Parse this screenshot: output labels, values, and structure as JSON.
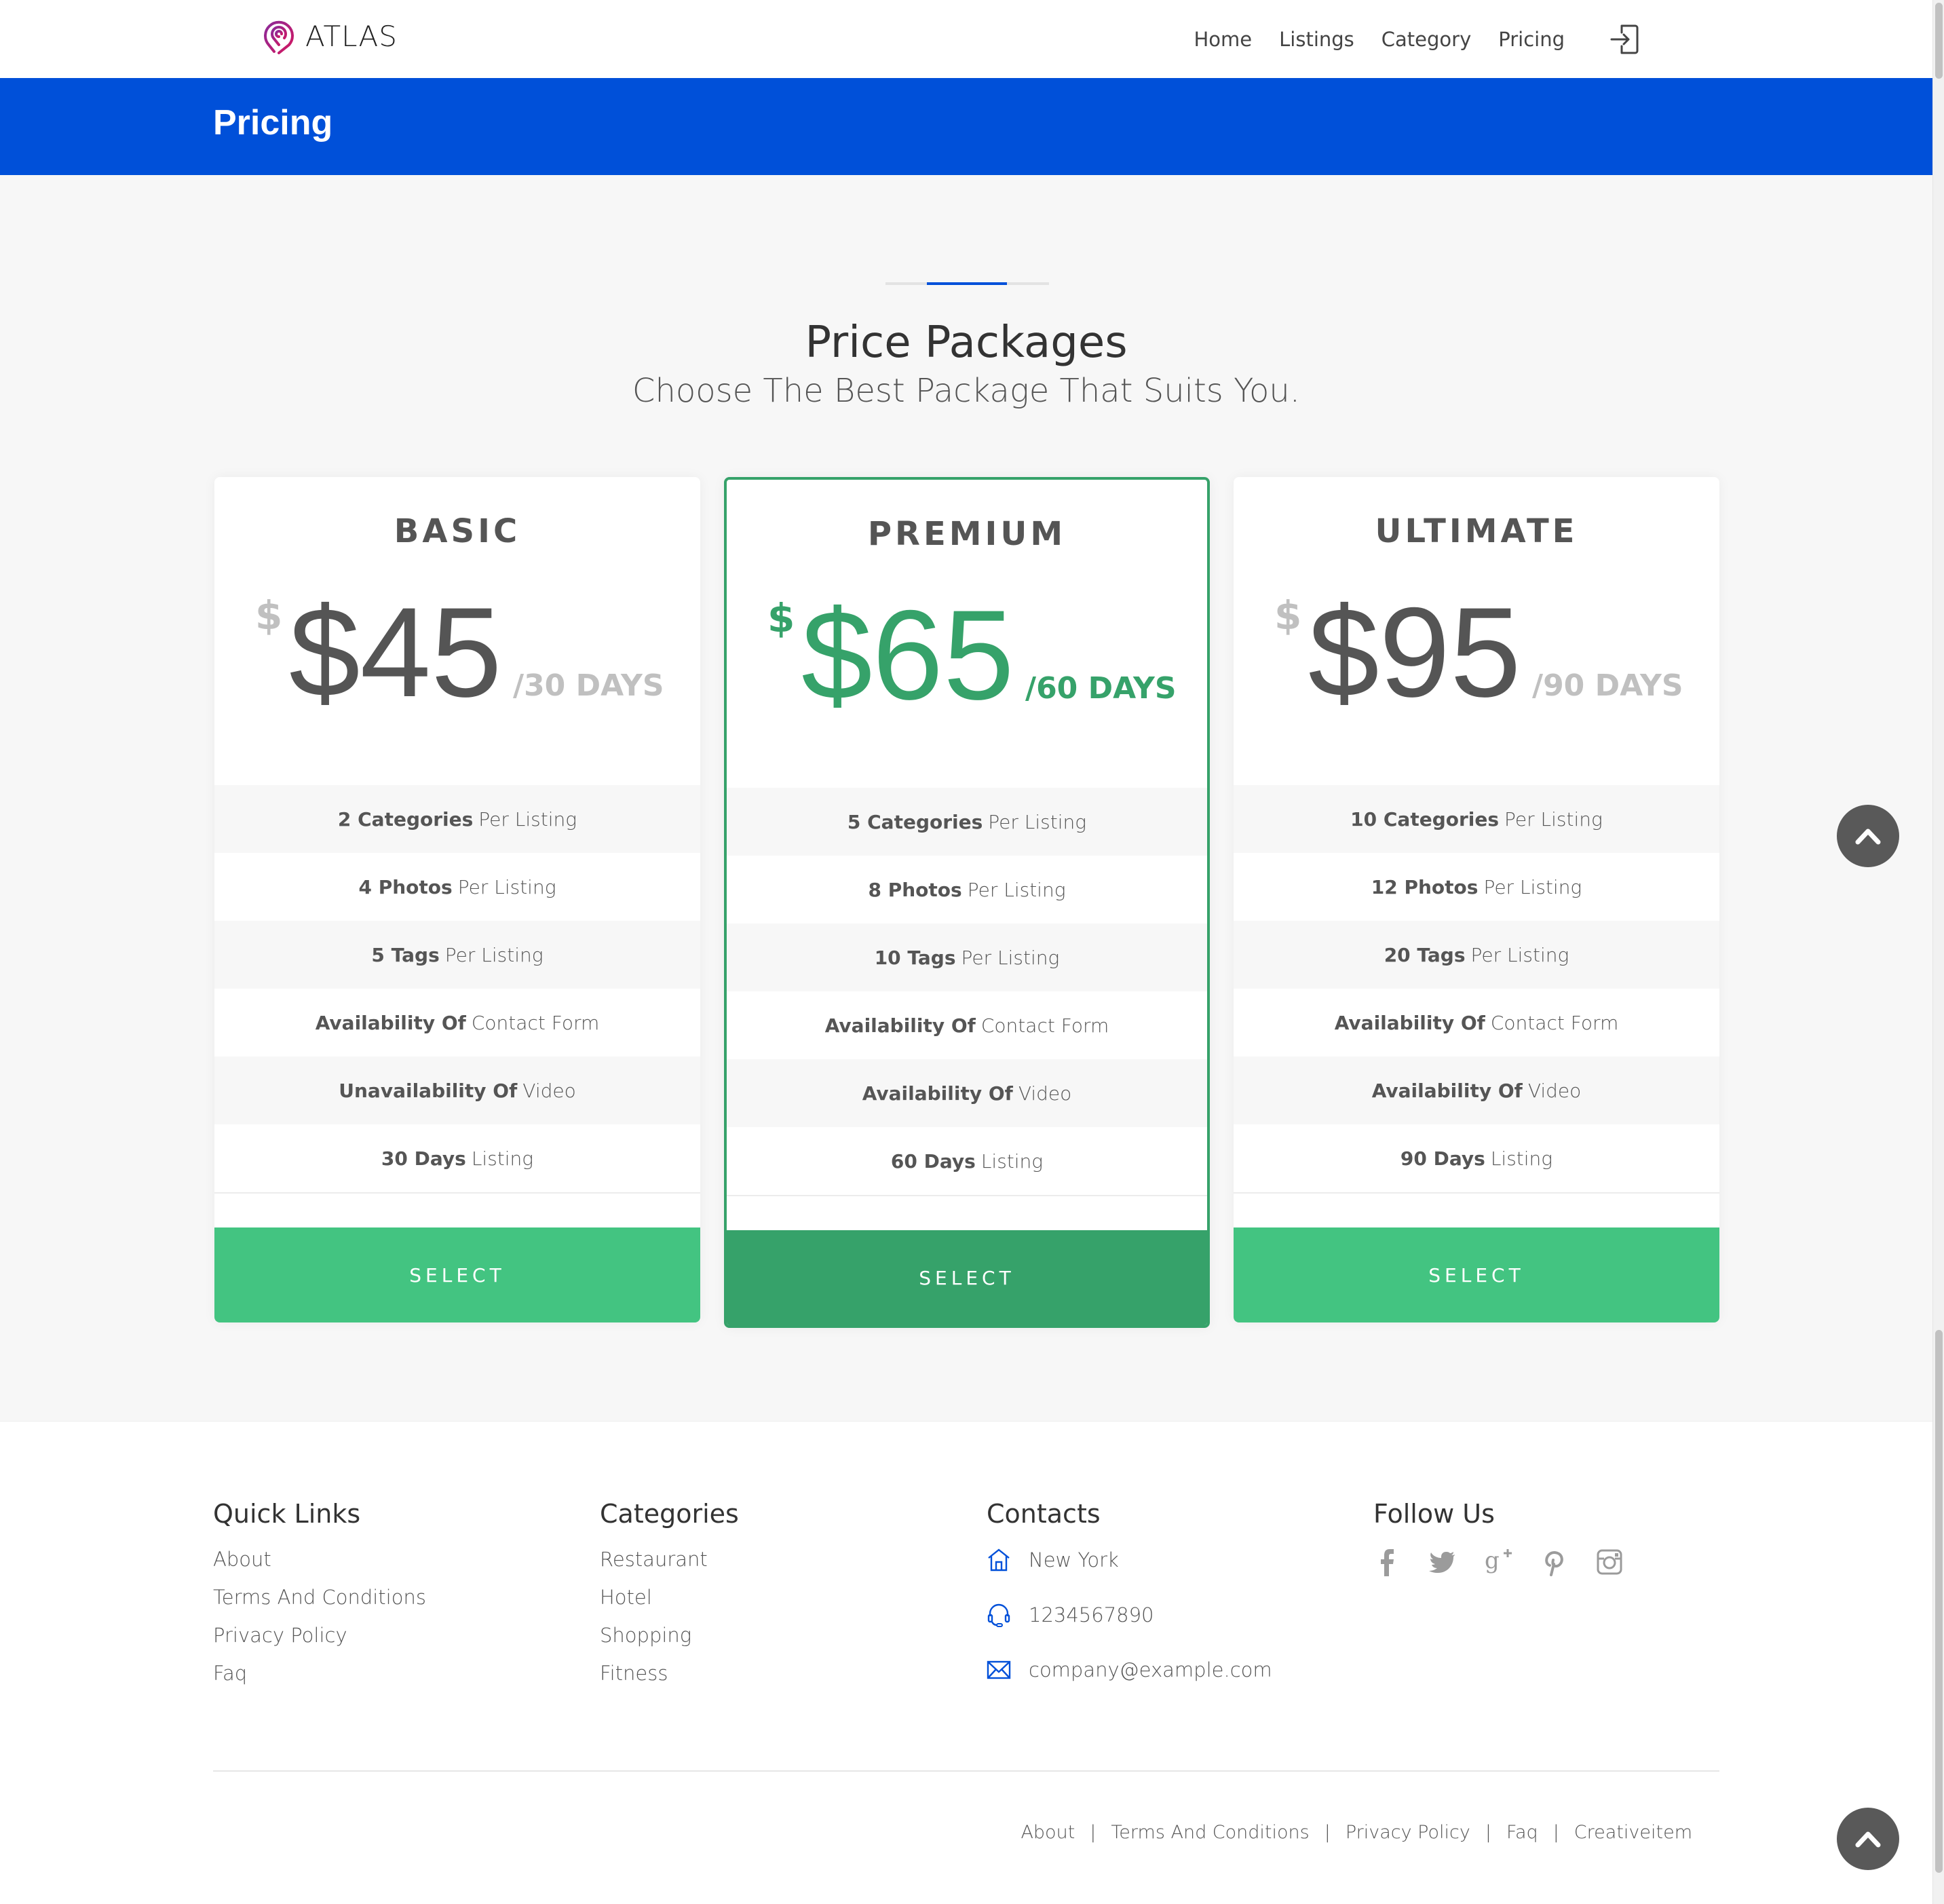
{
  "nav": {
    "brand": "ATLAS",
    "links": [
      "Home",
      "Listings",
      "Category",
      "Pricing"
    ],
    "signin_icon": "sign-in-icon"
  },
  "banner": {
    "title": "Pricing"
  },
  "section": {
    "title": "Price Packages",
    "subtitle": "Choose The Best Package That Suits You."
  },
  "colors": {
    "primary_blue": "#0050d9",
    "green": "#43c481",
    "green_dark": "#36a26a",
    "brand_magenta": "#b01b7a"
  },
  "plans": [
    {
      "name": "BASIC",
      "currency": "$",
      "price": "$45",
      "period": "/30 DAYS",
      "features": [
        {
          "bold": "2 Categories",
          "rest": "Per Listing"
        },
        {
          "bold": "4 Photos",
          "rest": "Per Listing"
        },
        {
          "bold": "5 Tags",
          "rest": "Per Listing"
        },
        {
          "bold": "Availability Of",
          "rest": "Contact Form"
        },
        {
          "bold": "Unavailability Of",
          "rest": "Video"
        },
        {
          "bold": "30 Days",
          "rest": "Listing"
        }
      ],
      "button": "SELECT"
    },
    {
      "name": "PREMIUM",
      "currency": "$",
      "price": "$65",
      "period": "/60 DAYS",
      "features": [
        {
          "bold": "5 Categories",
          "rest": "Per Listing"
        },
        {
          "bold": "8 Photos",
          "rest": "Per Listing"
        },
        {
          "bold": "10 Tags",
          "rest": "Per Listing"
        },
        {
          "bold": "Availability Of",
          "rest": "Contact Form"
        },
        {
          "bold": "Availability Of",
          "rest": "Video"
        },
        {
          "bold": "60 Days",
          "rest": "Listing"
        }
      ],
      "button": "SELECT"
    },
    {
      "name": "ULTIMATE",
      "currency": "$",
      "price": "$95",
      "period": "/90 DAYS",
      "features": [
        {
          "bold": "10 Categories",
          "rest": "Per Listing"
        },
        {
          "bold": "12 Photos",
          "rest": "Per Listing"
        },
        {
          "bold": "20 Tags",
          "rest": "Per Listing"
        },
        {
          "bold": "Availability Of",
          "rest": "Contact Form"
        },
        {
          "bold": "Availability Of",
          "rest": "Video"
        },
        {
          "bold": "90 Days",
          "rest": "Listing"
        }
      ],
      "button": "SELECT"
    }
  ],
  "footer": {
    "quick_links": {
      "title": "Quick Links",
      "items": [
        "About",
        "Terms And Conditions",
        "Privacy Policy",
        "Faq"
      ]
    },
    "categories": {
      "title": "Categories",
      "items": [
        "Restaurant",
        "Hotel",
        "Shopping",
        "Fitness"
      ]
    },
    "contacts": {
      "title": "Contacts",
      "address": "New York",
      "phone": "1234567890",
      "email": "company@example.com"
    },
    "follow": {
      "title": "Follow Us",
      "icons": [
        "facebook-icon",
        "twitter-icon",
        "google-plus-icon",
        "pinterest-icon",
        "instagram-icon"
      ]
    },
    "bottom_links": [
      "About",
      "Terms And Conditions",
      "Privacy Policy",
      "Faq",
      "Creativeitem"
    ],
    "separator": "|"
  }
}
